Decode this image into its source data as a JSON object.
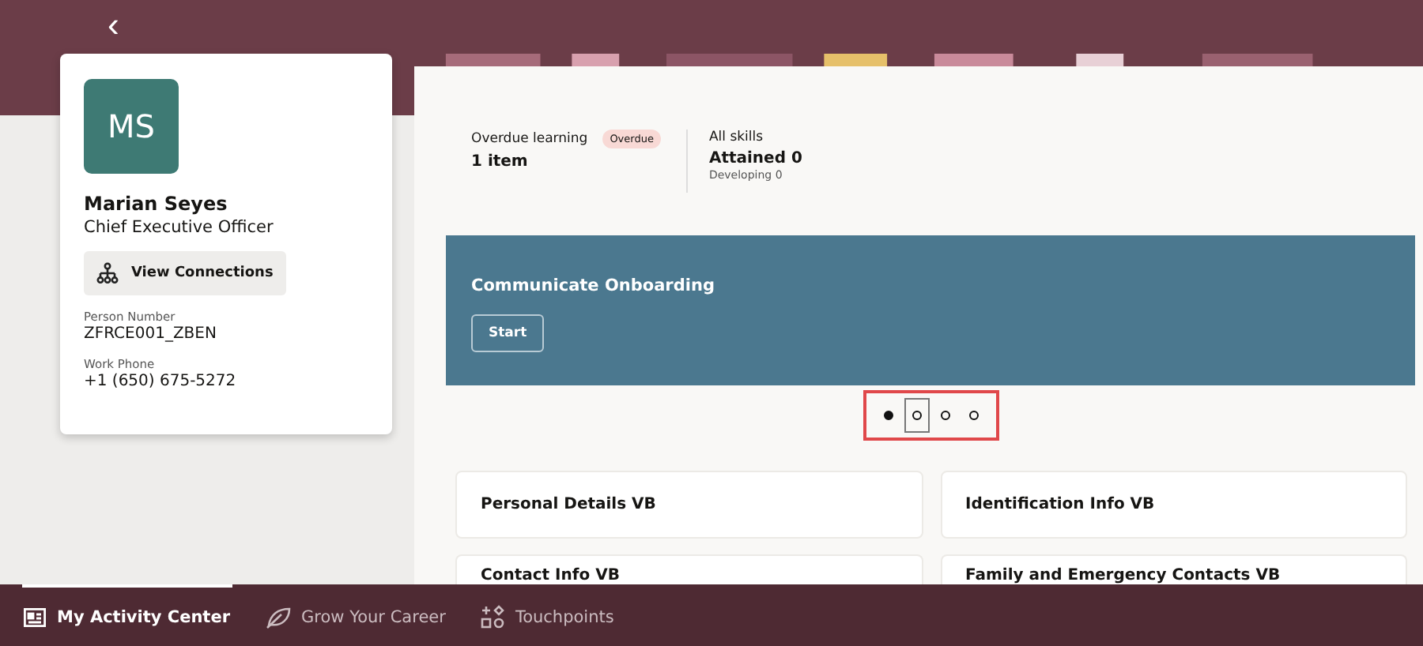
{
  "header": {
    "back": "‹"
  },
  "profile": {
    "initials": "MS",
    "name": "Marian Seyes",
    "job_title": "Chief Executive Officer",
    "connections_button": "View Connections",
    "fields": [
      {
        "label": "Person Number",
        "value": "ZFRCE001_ZBEN"
      },
      {
        "label": "Work Phone",
        "value": "+1 (650) 675-5272"
      }
    ]
  },
  "summary": [
    {
      "label": "Overdue learning",
      "badge": "Overdue",
      "value": "1 item"
    },
    {
      "label": "All skills",
      "value": "Attained 0",
      "note": "Developing 0"
    }
  ],
  "carousel": {
    "title": "Communicate Onboarding",
    "button": "Start",
    "dots": [
      {
        "selected": true,
        "focused": false
      },
      {
        "selected": false,
        "focused": true
      },
      {
        "selected": false,
        "focused": false
      },
      {
        "selected": false,
        "focused": false
      }
    ]
  },
  "cards": [
    "Personal Details VB",
    "Identification Info VB",
    "Contact Info VB",
    "Family and Emergency Contacts VB"
  ],
  "bottom_nav": [
    {
      "label": "My Activity Center",
      "kind": "activity",
      "selected": true
    },
    {
      "label": "Grow Your Career",
      "kind": "career",
      "selected": false
    },
    {
      "label": "Touchpoints",
      "kind": "touchpoints",
      "selected": false
    }
  ]
}
